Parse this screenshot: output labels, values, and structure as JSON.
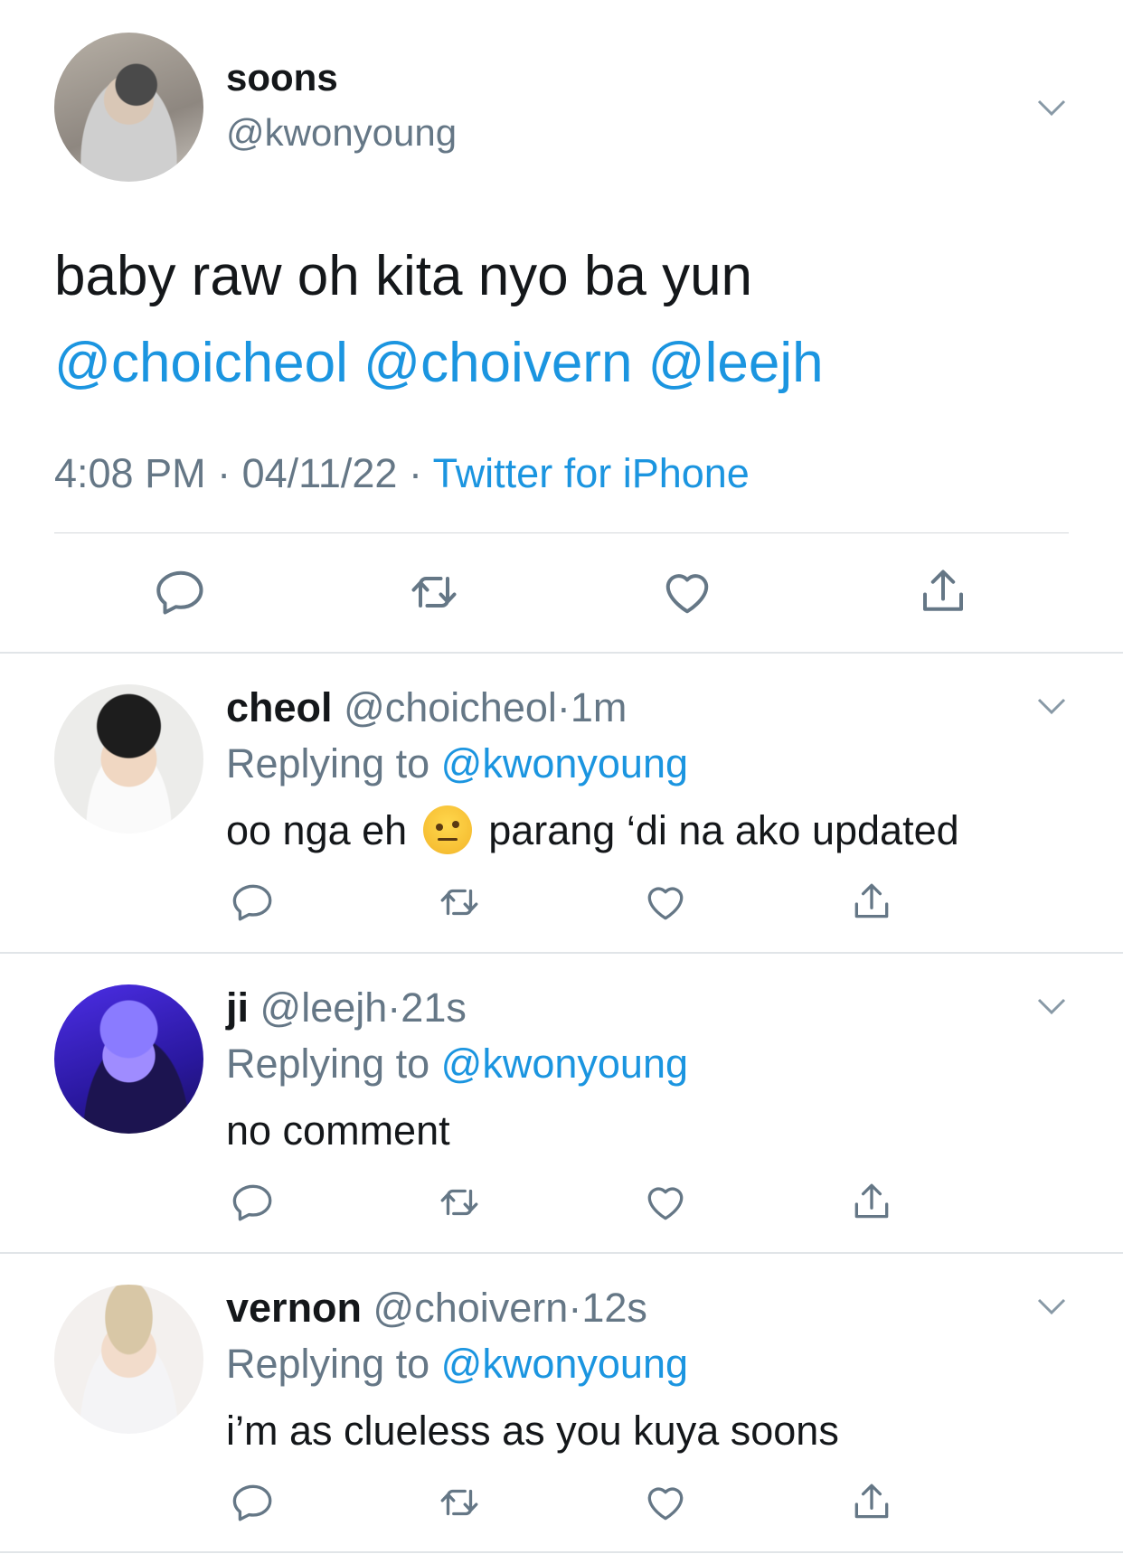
{
  "main_tweet": {
    "name": "soons",
    "handle": "@kwonyoung",
    "text": "baby raw oh kita nyo ba yun",
    "mentions": [
      "@choicheol",
      "@choivern",
      "@leejh"
    ],
    "time": "4:08 PM",
    "date": "04/11/22",
    "source": "Twitter for iPhone",
    "separator": "·"
  },
  "replies": [
    {
      "name": "cheol",
      "handle": "@choicheol",
      "time": "1m",
      "replying_label": "Replying to",
      "replying_to": "@kwonyoung",
      "text_before": "oo nga eh",
      "emoji": "face-with-raised-eyebrow",
      "text_after": "parang ‘di na ako updated"
    },
    {
      "name": "ji",
      "handle": "@leejh",
      "time": "21s",
      "replying_label": "Replying to",
      "replying_to": "@kwonyoung",
      "text": "no comment"
    },
    {
      "name": "vernon",
      "handle": "@choivern",
      "time": "12s",
      "replying_label": "Replying to",
      "replying_to": "@kwonyoung",
      "text": "i’m as clueless as you kuya soons"
    }
  ],
  "icons": [
    "reply-icon",
    "retweet-icon",
    "like-icon",
    "share-icon",
    "chevron-down-icon"
  ],
  "colors": {
    "link": "#1b95e0",
    "secondary": "#657786",
    "text": "#14171a",
    "divider": "#e1e5e8"
  }
}
